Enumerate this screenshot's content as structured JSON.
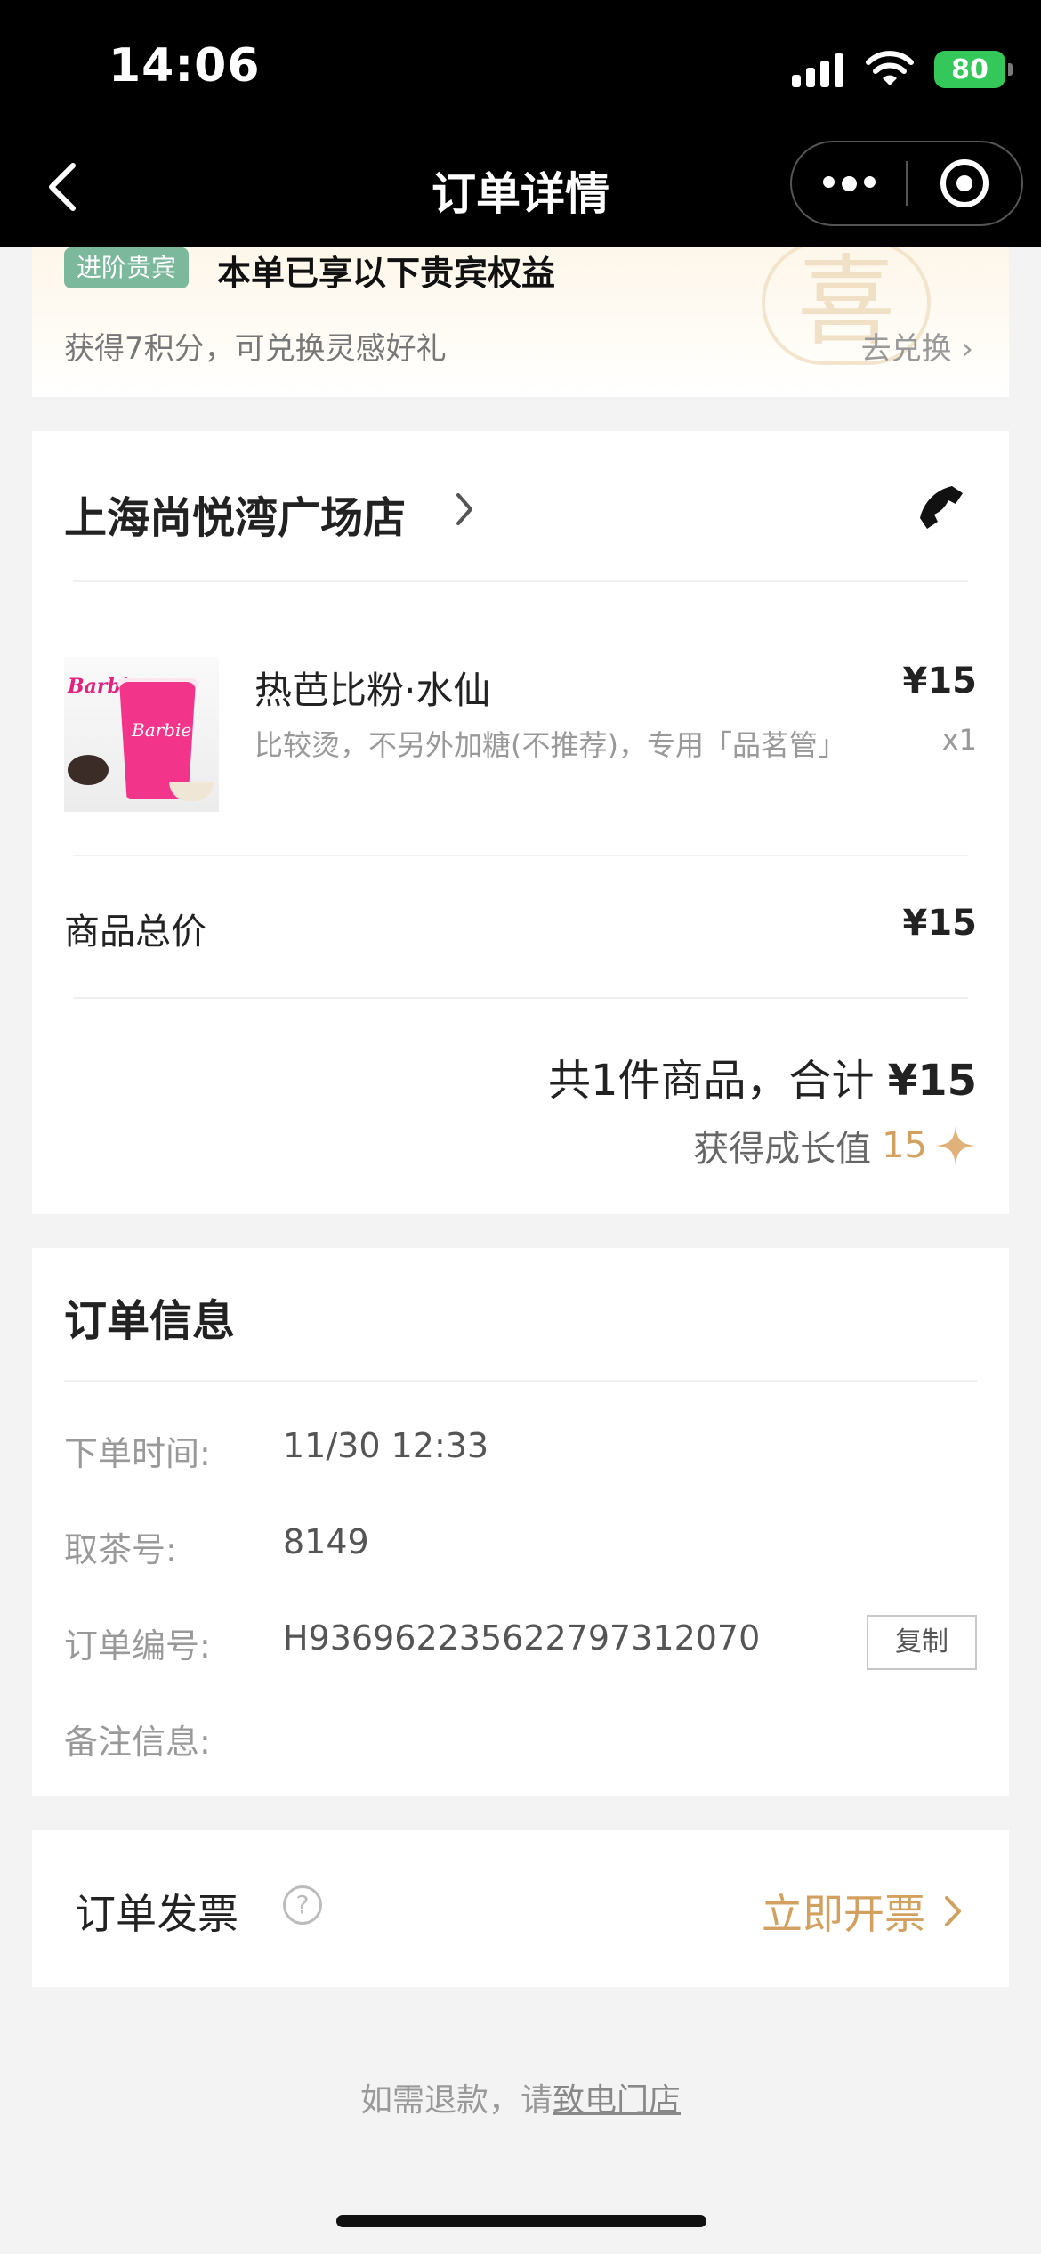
{
  "status_bar": {
    "time": "14:06",
    "battery": "80"
  },
  "nav": {
    "title": "订单详情"
  },
  "vip": {
    "badge": "进阶贵宾",
    "title": "本单已享以下贵宾权益",
    "subtitle": "获得7积分，可兑换灵感好礼",
    "link": "去兑换",
    "seal_char": "喜"
  },
  "store": {
    "name": "上海尚悦湾广场店"
  },
  "product": {
    "image_brand": "Barbie",
    "name": "热芭比粉·水仙",
    "spec": "比较烫，不另外加糖(不推荐)，专用「品茗管」",
    "price": "¥15",
    "qty": "x1"
  },
  "totals": {
    "goods_label": "商品总价",
    "goods_value": "¥15",
    "summary_prefix": "共1件商品，合计 ",
    "summary_amount": "¥15",
    "growth_label": "获得成长值",
    "growth_value": "15"
  },
  "order_info": {
    "title": "订单信息",
    "rows": [
      {
        "label": "下单时间:",
        "value": "11/30 12:33"
      },
      {
        "label": "取茶号:",
        "value": "8149"
      },
      {
        "label": "订单编号:",
        "value": "H9369622356227973120​70"
      },
      {
        "label": "备注信息:",
        "value": ""
      }
    ],
    "copy_label": "复制"
  },
  "invoice": {
    "label": "订单发票",
    "help": "?",
    "action": "立即开票"
  },
  "footer": {
    "refund_prefix": "如需退款，请",
    "refund_link": "致电门店"
  },
  "colors": {
    "accent_gold": "#d3a15f",
    "vip_green": "#7cb89c",
    "battery_green": "#34c759"
  },
  "icons": [
    "back-icon",
    "more-icon",
    "target-icon",
    "chevron-right-icon",
    "phone-icon",
    "star-icon",
    "help-icon",
    "signal-icon",
    "wifi-icon"
  ]
}
